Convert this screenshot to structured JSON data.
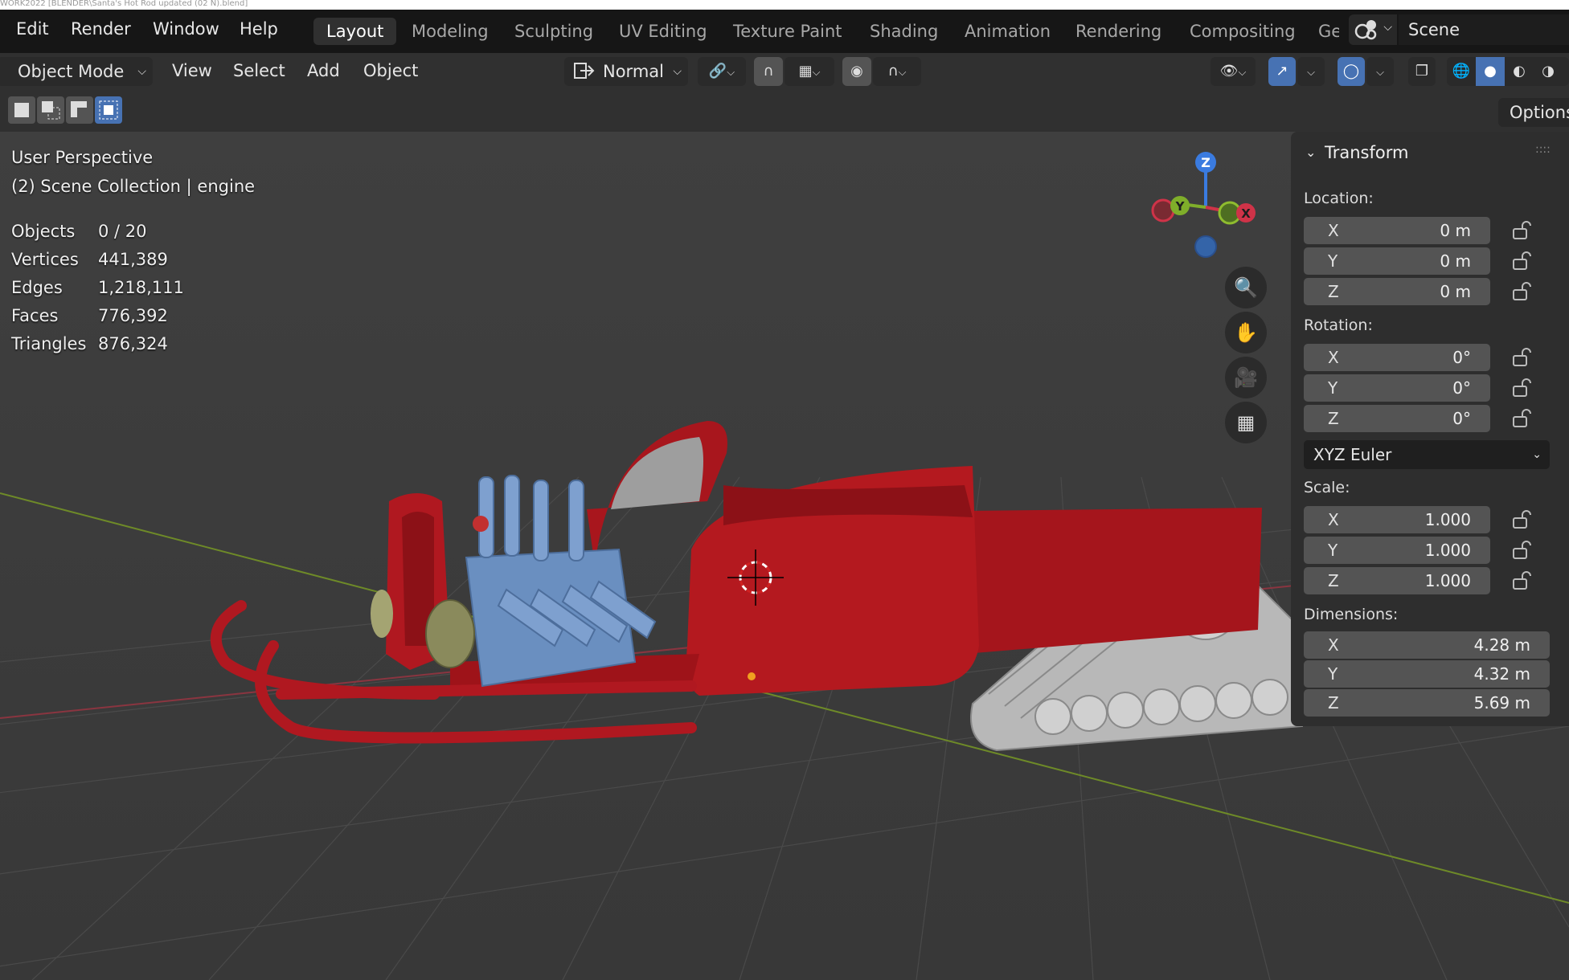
{
  "window": {
    "title": "WORK2022 [BLENDER\\Santa's Hot Rod updated (02 N).blend]"
  },
  "topmenu": [
    "Edit",
    "Render",
    "Window",
    "Help"
  ],
  "workspaces": [
    "Layout",
    "Modeling",
    "Sculpting",
    "UV Editing",
    "Texture Paint",
    "Shading",
    "Animation",
    "Rendering",
    "Compositing",
    "Ge"
  ],
  "active_workspace": "Layout",
  "scene": {
    "label": "Scene"
  },
  "header": {
    "mode": "Object Mode",
    "menus": [
      "View",
      "Select",
      "Add",
      "Object"
    ],
    "orientation": "Normal"
  },
  "toolrow": {
    "options": "Options"
  },
  "viewport": {
    "view_name": "User Perspective",
    "collection": "(2) Scene Collection | engine",
    "stats": [
      {
        "label": "Objects",
        "value": "0 / 20"
      },
      {
        "label": "Vertices",
        "value": "441,389"
      },
      {
        "label": "Edges",
        "value": "1,218,111"
      },
      {
        "label": "Faces",
        "value": "776,392"
      },
      {
        "label": "Triangles",
        "value": "876,324"
      }
    ],
    "gizmo": {
      "z": "Z",
      "y": "Y",
      "x": "X"
    },
    "nav_icons": [
      "zoom-icon",
      "hand-icon",
      "camera-icon",
      "grid-icon"
    ]
  },
  "transform": {
    "title": "Transform",
    "location": {
      "label": "Location:",
      "rows": [
        {
          "axis": "X",
          "value": "0 m"
        },
        {
          "axis": "Y",
          "value": "0 m"
        },
        {
          "axis": "Z",
          "value": "0 m"
        }
      ]
    },
    "rotation": {
      "label": "Rotation:",
      "rows": [
        {
          "axis": "X",
          "value": "0°"
        },
        {
          "axis": "Y",
          "value": "0°"
        },
        {
          "axis": "Z",
          "value": "0°"
        }
      ]
    },
    "rotation_mode": "XYZ Euler",
    "scale": {
      "label": "Scale:",
      "rows": [
        {
          "axis": "X",
          "value": "1.000"
        },
        {
          "axis": "Y",
          "value": "1.000"
        },
        {
          "axis": "Z",
          "value": "1.000"
        }
      ]
    },
    "dimensions": {
      "label": "Dimensions:",
      "rows": [
        {
          "axis": "X",
          "value": "4.28 m"
        },
        {
          "axis": "Y",
          "value": "4.32 m"
        },
        {
          "axis": "Z",
          "value": "5.69 m"
        }
      ]
    }
  },
  "colors": {
    "accent": "#4772b3",
    "sled_red": "#b01820",
    "engine_blue": "#6a8fc0",
    "track_gray": "#bdbdbd"
  }
}
